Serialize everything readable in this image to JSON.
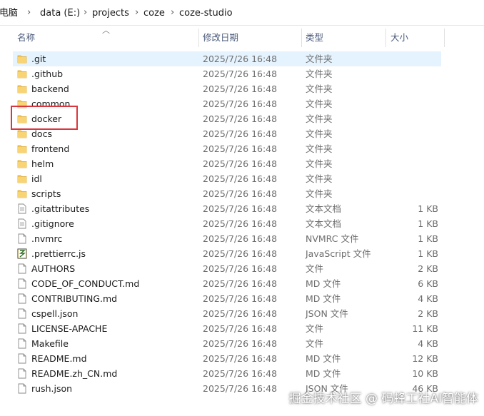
{
  "breadcrumb": [
    "此电脑",
    "data (E:)",
    "projects",
    "coze",
    "coze-studio"
  ],
  "columns": {
    "name": "名称",
    "modified": "修改日期",
    "type": "类型",
    "size": "大小"
  },
  "files": [
    {
      "name": ".git",
      "date": "2025/7/26 16:48",
      "type": "文件夹",
      "size": "",
      "icon": "folder-icon"
    },
    {
      "name": ".github",
      "date": "2025/7/26 16:48",
      "type": "文件夹",
      "size": "",
      "icon": "folder-icon"
    },
    {
      "name": "backend",
      "date": "2025/7/26 16:48",
      "type": "文件夹",
      "size": "",
      "icon": "folder-icon"
    },
    {
      "name": "common",
      "date": "2025/7/26 16:48",
      "type": "文件夹",
      "size": "",
      "icon": "folder-icon"
    },
    {
      "name": "docker",
      "date": "2025/7/26 16:48",
      "type": "文件夹",
      "size": "",
      "icon": "folder-icon"
    },
    {
      "name": "docs",
      "date": "2025/7/26 16:48",
      "type": "文件夹",
      "size": "",
      "icon": "folder-icon"
    },
    {
      "name": "frontend",
      "date": "2025/7/26 16:48",
      "type": "文件夹",
      "size": "",
      "icon": "folder-icon"
    },
    {
      "name": "helm",
      "date": "2025/7/26 16:48",
      "type": "文件夹",
      "size": "",
      "icon": "folder-icon"
    },
    {
      "name": "idl",
      "date": "2025/7/26 16:48",
      "type": "文件夹",
      "size": "",
      "icon": "folder-icon"
    },
    {
      "name": "scripts",
      "date": "2025/7/26 16:48",
      "type": "文件夹",
      "size": "",
      "icon": "folder-icon"
    },
    {
      "name": ".gitattributes",
      "date": "2025/7/26 16:48",
      "type": "文本文档",
      "size": "1 KB",
      "icon": "text-file-icon"
    },
    {
      "name": ".gitignore",
      "date": "2025/7/26 16:48",
      "type": "文本文档",
      "size": "1 KB",
      "icon": "text-file-icon"
    },
    {
      "name": ".nvmrc",
      "date": "2025/7/26 16:48",
      "type": "NVMRC 文件",
      "size": "1 KB",
      "icon": "file-icon"
    },
    {
      "name": ".prettierrc.js",
      "date": "2025/7/26 16:48",
      "type": "JavaScript 文件",
      "size": "1 KB",
      "icon": "script-file-icon"
    },
    {
      "name": "AUTHORS",
      "date": "2025/7/26 16:48",
      "type": "文件",
      "size": "2 KB",
      "icon": "file-icon"
    },
    {
      "name": "CODE_OF_CONDUCT.md",
      "date": "2025/7/26 16:48",
      "type": "MD 文件",
      "size": "6 KB",
      "icon": "file-icon"
    },
    {
      "name": "CONTRIBUTING.md",
      "date": "2025/7/26 16:48",
      "type": "MD 文件",
      "size": "4 KB",
      "icon": "file-icon"
    },
    {
      "name": "cspell.json",
      "date": "2025/7/26 16:48",
      "type": "JSON 文件",
      "size": "2 KB",
      "icon": "file-icon"
    },
    {
      "name": "LICENSE-APACHE",
      "date": "2025/7/26 16:48",
      "type": "文件",
      "size": "11 KB",
      "icon": "file-icon"
    },
    {
      "name": "Makefile",
      "date": "2025/7/26 16:48",
      "type": "文件",
      "size": "4 KB",
      "icon": "file-icon"
    },
    {
      "name": "README.md",
      "date": "2025/7/26 16:48",
      "type": "MD 文件",
      "size": "12 KB",
      "icon": "file-icon"
    },
    {
      "name": "README.zh_CN.md",
      "date": "2025/7/26 16:48",
      "type": "MD 文件",
      "size": "10 KB",
      "icon": "file-icon"
    },
    {
      "name": "rush.json",
      "date": "2025/7/26 16:48",
      "type": "JSON 文件",
      "size": "46 KB",
      "icon": "file-icon"
    }
  ],
  "selected_index": 0,
  "highlighted_name": "docker",
  "watermark": "掘金技术社区 @ 码蜂工社AI智能体",
  "colors": {
    "selection": "#e5f3ff",
    "highlight_border": "#d9363e",
    "folder": "#f4c554"
  }
}
